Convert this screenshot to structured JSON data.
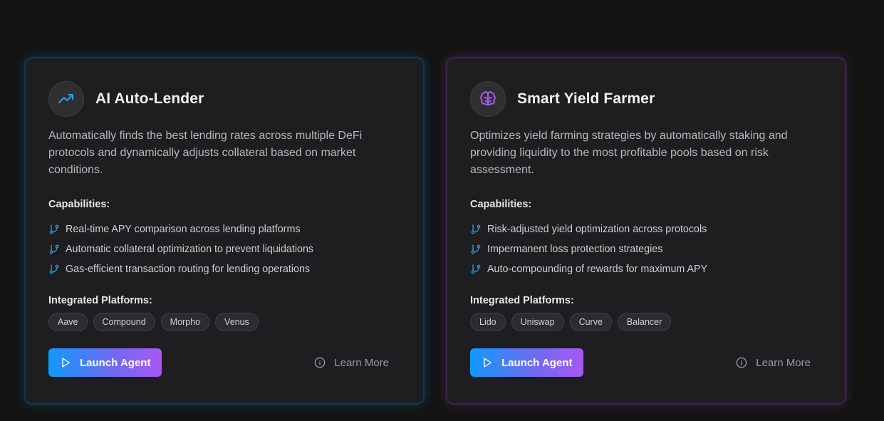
{
  "agents": [
    {
      "icon": "trending-up-icon",
      "title": "AI Auto-Lender",
      "description": "Automatically finds the best lending rates across multiple DeFi protocols and dynamically adjusts collateral based on market conditions.",
      "capabilities_label": "Capabilities:",
      "capabilities": [
        "Real-time APY comparison across lending platforms",
        "Automatic collateral optimization to prevent liquidations",
        "Gas-efficient transaction routing for lending operations"
      ],
      "platforms_label": "Integrated Platforms:",
      "platforms": [
        "Aave",
        "Compound",
        "Morpho",
        "Venus"
      ],
      "launch_label": "Launch Agent",
      "learn_label": "Learn More"
    },
    {
      "icon": "brain-icon",
      "title": "Smart Yield Farmer",
      "description": "Optimizes yield farming strategies by automatically staking and providing liquidity to the most profitable pools based on risk assessment.",
      "capabilities_label": "Capabilities:",
      "capabilities": [
        "Risk-adjusted yield optimization across protocols",
        "Impermanent loss protection strategies",
        "Auto-compounding of rewards for maximum APY"
      ],
      "platforms_label": "Integrated Platforms:",
      "platforms": [
        "Lido",
        "Uniswap",
        "Curve",
        "Balancer"
      ],
      "launch_label": "Launch Agent",
      "learn_label": "Learn More"
    }
  ],
  "colors": {
    "background": "#141414",
    "card": "#1e1e20",
    "accent_blue": "#1199ff",
    "accent_purple": "#a857f5"
  }
}
